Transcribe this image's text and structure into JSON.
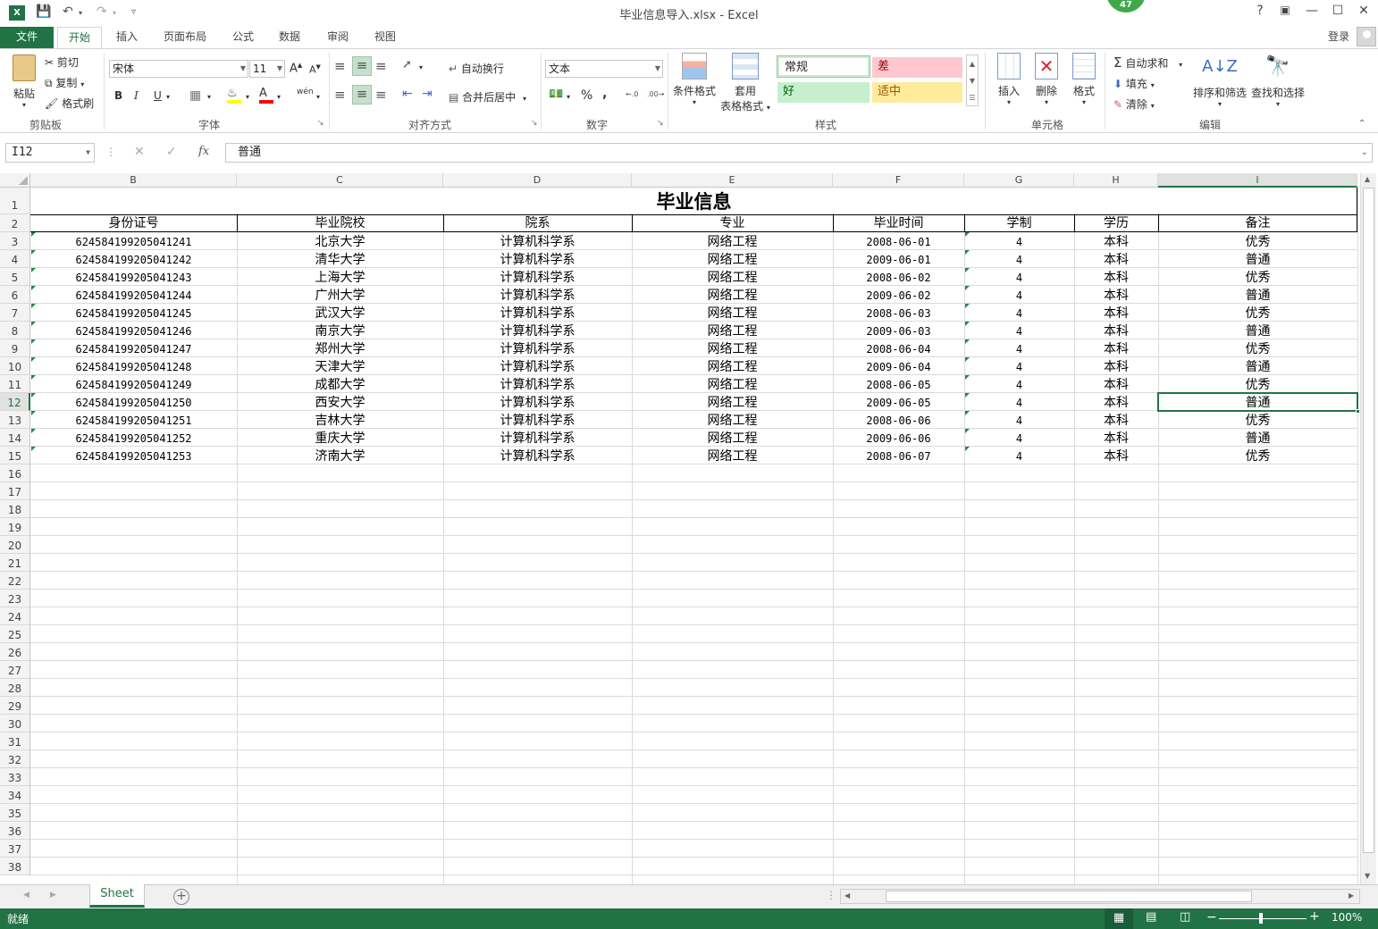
{
  "window": {
    "title": "毕业信息导入.xlsx - Excel",
    "badge": "47",
    "help": "?",
    "signin": "登录"
  },
  "tabs": {
    "file": "文件",
    "items": [
      "开始",
      "插入",
      "页面布局",
      "公式",
      "数据",
      "审阅",
      "视图"
    ],
    "active": "开始"
  },
  "ribbon": {
    "clipboard": {
      "paste": "粘贴",
      "cut": "剪切",
      "copy": "复制",
      "painter": "格式刷",
      "label": "剪贴板"
    },
    "font": {
      "name": "宋体",
      "size": "11",
      "label": "字体",
      "bold": "B",
      "italic": "I",
      "underline": "U",
      "grow": "A",
      "shrink": "A",
      "phonetic": "wén"
    },
    "alignment": {
      "wrap": "自动换行",
      "merge": "合并后居中",
      "label": "对齐方式"
    },
    "number": {
      "format": "文本",
      "percent": "%",
      "comma": ",",
      "label": "数字"
    },
    "styles": {
      "conditional": "条件格式",
      "table_format_1": "套用",
      "table_format_2": "表格格式",
      "normal": "常规",
      "bad": "差",
      "good": "好",
      "neutral": "适中",
      "label": "样式"
    },
    "cells": {
      "insert": "插入",
      "delete": "删除",
      "format": "格式",
      "label": "单元格"
    },
    "editing": {
      "autosum": "自动求和",
      "fill": "填充",
      "clear": "清除",
      "sort": "排序和筛选",
      "find": "查找和选择",
      "label": "编辑"
    }
  },
  "formula_bar": {
    "name_box": "I12",
    "fx": "fx",
    "content": "普通"
  },
  "sheet": {
    "columns": [
      "B",
      "C",
      "D",
      "E",
      "F",
      "G",
      "H",
      "I"
    ],
    "selected_column": "I",
    "selected_row": 12,
    "title": "毕业信息",
    "headers": [
      "身份证号",
      "毕业院校",
      "院系",
      "专业",
      "毕业时间",
      "学制",
      "学历",
      "备注"
    ],
    "rows": [
      [
        "624584199205041241",
        "北京大学",
        "计算机科学系",
        "网络工程",
        "2008-06-01",
        "4",
        "本科",
        "优秀"
      ],
      [
        "624584199205041242",
        "清华大学",
        "计算机科学系",
        "网络工程",
        "2009-06-01",
        "4",
        "本科",
        "普通"
      ],
      [
        "624584199205041243",
        "上海大学",
        "计算机科学系",
        "网络工程",
        "2008-06-02",
        "4",
        "本科",
        "优秀"
      ],
      [
        "624584199205041244",
        "广州大学",
        "计算机科学系",
        "网络工程",
        "2009-06-02",
        "4",
        "本科",
        "普通"
      ],
      [
        "624584199205041245",
        "武汉大学",
        "计算机科学系",
        "网络工程",
        "2008-06-03",
        "4",
        "本科",
        "优秀"
      ],
      [
        "624584199205041246",
        "南京大学",
        "计算机科学系",
        "网络工程",
        "2009-06-03",
        "4",
        "本科",
        "普通"
      ],
      [
        "624584199205041247",
        "郑州大学",
        "计算机科学系",
        "网络工程",
        "2008-06-04",
        "4",
        "本科",
        "优秀"
      ],
      [
        "624584199205041248",
        "天津大学",
        "计算机科学系",
        "网络工程",
        "2009-06-04",
        "4",
        "本科",
        "普通"
      ],
      [
        "624584199205041249",
        "成都大学",
        "计算机科学系",
        "网络工程",
        "2008-06-05",
        "4",
        "本科",
        "优秀"
      ],
      [
        "624584199205041250",
        "西安大学",
        "计算机科学系",
        "网络工程",
        "2009-06-05",
        "4",
        "本科",
        "普通"
      ],
      [
        "624584199205041251",
        "吉林大学",
        "计算机科学系",
        "网络工程",
        "2008-06-06",
        "4",
        "本科",
        "优秀"
      ],
      [
        "624584199205041252",
        "重庆大学",
        "计算机科学系",
        "网络工程",
        "2009-06-06",
        "4",
        "本科",
        "普通"
      ],
      [
        "624584199205041253",
        "济南大学",
        "计算机科学系",
        "网络工程",
        "2008-06-07",
        "4",
        "本科",
        "优秀"
      ]
    ],
    "row_numbers": [
      "1",
      "2",
      "3",
      "4",
      "5",
      "6",
      "7",
      "8",
      "9",
      "10",
      "11",
      "12",
      "13",
      "14",
      "15",
      "16",
      "17",
      "18",
      "19",
      "20",
      "21",
      "22",
      "23",
      "24",
      "25",
      "26",
      "27",
      "28",
      "29",
      "30",
      "31",
      "32",
      "33",
      "34",
      "35",
      "36",
      "37",
      "38"
    ]
  },
  "sheet_tabs": {
    "active": "Sheet",
    "add": "+"
  },
  "status": {
    "ready": "就绪",
    "zoom": "100%"
  },
  "colors": {
    "accent": "#217346",
    "bad_bg": "#ffc7ce",
    "bad_fg": "#9c0006",
    "good_bg": "#c6efce",
    "good_fg": "#006100",
    "neutral_bg": "#ffeb9c",
    "neutral_fg": "#9c5700"
  }
}
